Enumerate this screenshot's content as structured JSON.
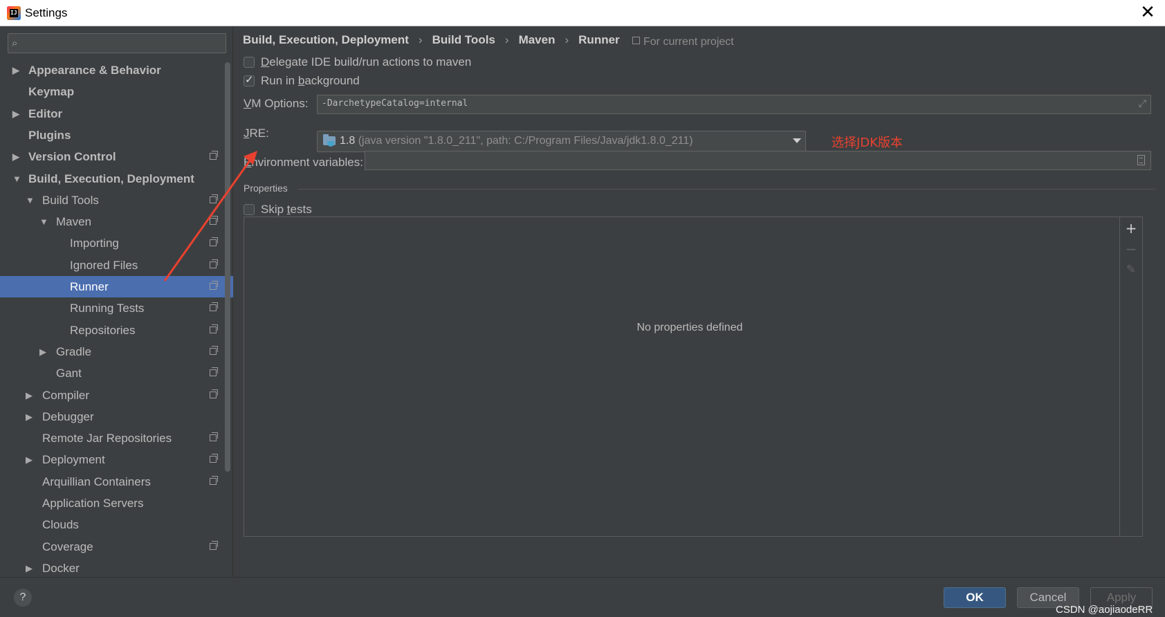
{
  "window": {
    "title": "Settings",
    "close_symbol": "✕"
  },
  "search": {
    "placeholder": ""
  },
  "tree": [
    {
      "label": "Appearance & Behavior",
      "bold": true,
      "arrow": "right",
      "level": 0,
      "proj": false
    },
    {
      "label": "Keymap",
      "bold": true,
      "arrow": "",
      "level": 0,
      "proj": false
    },
    {
      "label": "Editor",
      "bold": true,
      "arrow": "right",
      "level": 0,
      "proj": false
    },
    {
      "label": "Plugins",
      "bold": true,
      "arrow": "",
      "level": 0,
      "proj": false
    },
    {
      "label": "Version Control",
      "bold": true,
      "arrow": "right",
      "level": 0,
      "proj": true
    },
    {
      "label": "Build, Execution, Deployment",
      "bold": true,
      "arrow": "down",
      "level": 0,
      "proj": false
    },
    {
      "label": "Build Tools",
      "bold": false,
      "arrow": "down",
      "level": 1,
      "proj": true
    },
    {
      "label": "Maven",
      "bold": false,
      "arrow": "down",
      "level": 2,
      "proj": true
    },
    {
      "label": "Importing",
      "bold": false,
      "arrow": "",
      "level": 3,
      "proj": true
    },
    {
      "label": "Ignored Files",
      "bold": false,
      "arrow": "",
      "level": 3,
      "proj": true
    },
    {
      "label": "Runner",
      "bold": false,
      "arrow": "",
      "level": 3,
      "proj": true,
      "selected": true
    },
    {
      "label": "Running Tests",
      "bold": false,
      "arrow": "",
      "level": 3,
      "proj": true
    },
    {
      "label": "Repositories",
      "bold": false,
      "arrow": "",
      "level": 3,
      "proj": true
    },
    {
      "label": "Gradle",
      "bold": false,
      "arrow": "right",
      "level": 2,
      "proj": true
    },
    {
      "label": "Gant",
      "bold": false,
      "arrow": "",
      "level": 2,
      "proj": true
    },
    {
      "label": "Compiler",
      "bold": false,
      "arrow": "right",
      "level": 1,
      "proj": true
    },
    {
      "label": "Debugger",
      "bold": false,
      "arrow": "right",
      "level": 1,
      "proj": false
    },
    {
      "label": "Remote Jar Repositories",
      "bold": false,
      "arrow": "",
      "level": 1,
      "proj": true
    },
    {
      "label": "Deployment",
      "bold": false,
      "arrow": "right",
      "level": 1,
      "proj": true
    },
    {
      "label": "Arquillian Containers",
      "bold": false,
      "arrow": "",
      "level": 1,
      "proj": true
    },
    {
      "label": "Application Servers",
      "bold": false,
      "arrow": "",
      "level": 1,
      "proj": false
    },
    {
      "label": "Clouds",
      "bold": false,
      "arrow": "",
      "level": 1,
      "proj": false
    },
    {
      "label": "Coverage",
      "bold": false,
      "arrow": "",
      "level": 1,
      "proj": true
    },
    {
      "label": "Docker",
      "bold": false,
      "arrow": "right",
      "level": 1,
      "proj": false
    }
  ],
  "breadcrumb": [
    "Build, Execution, Deployment",
    "Build Tools",
    "Maven",
    "Runner"
  ],
  "breadcrumb_sep": "›",
  "scope_label": "For current project",
  "options": {
    "delegate": {
      "label_first": "D",
      "label_rest": "elegate IDE build/run actions to maven",
      "checked": false
    },
    "background": {
      "label_pre": "Run in ",
      "label_u": "b",
      "label_post": "ackground",
      "checked": true
    }
  },
  "vm": {
    "label_u": "V",
    "label_rest": "M Options:",
    "value": "-DarchetypeCatalog=internal"
  },
  "jre": {
    "label_u": "J",
    "label_rest": "RE:",
    "version": "1.8",
    "detail": " (java version \"1.8.0_211\", path: C:/Program Files/Java/jdk1.8.0_211)"
  },
  "annotation": "选择JDK版本",
  "env": {
    "label_u": "E",
    "label_rest": "nvironment variables:",
    "value": ""
  },
  "properties": {
    "title": "Properties",
    "skip_tests_pre": "Skip ",
    "skip_tests_u": "t",
    "skip_tests_post": "ests",
    "skip_checked": false,
    "empty_text": "No properties defined",
    "add_symbol": "+",
    "remove_symbol": "−",
    "edit_symbol": "✎"
  },
  "footer": {
    "help": "?",
    "ok": "OK",
    "cancel": "Cancel",
    "apply": "Apply"
  },
  "watermark": "CSDN @aojiaodeRR",
  "colors": {
    "selection": "#4b6eaf",
    "annotation": "#e8412f",
    "ok_button": "#365880"
  }
}
